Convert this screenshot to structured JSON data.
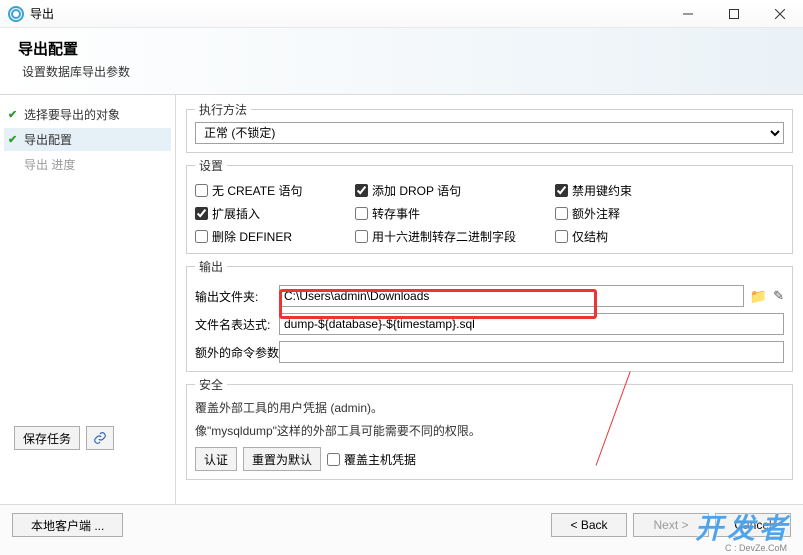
{
  "window": {
    "title": "导出"
  },
  "header": {
    "title": "导出配置",
    "subtitle": "设置数据库导出参数"
  },
  "steps": [
    {
      "label": "选择要导出的对象",
      "state": "done"
    },
    {
      "label": "导出配置",
      "state": "current"
    },
    {
      "label": "导出 进度",
      "state": "pending"
    }
  ],
  "method": {
    "legend": "执行方法",
    "selected": "正常 (不锁定)"
  },
  "settings": {
    "legend": "设置",
    "items": [
      {
        "label": "无 CREATE 语句",
        "checked": false
      },
      {
        "label": "添加 DROP 语句",
        "checked": true
      },
      {
        "label": "禁用键约束",
        "checked": true
      },
      {
        "label": "扩展插入",
        "checked": true
      },
      {
        "label": "转存事件",
        "checked": false
      },
      {
        "label": "额外注释",
        "checked": false
      },
      {
        "label": "删除 DEFINER",
        "checked": false
      },
      {
        "label": "用十六进制转存二进制字段",
        "checked": false
      },
      {
        "label": "仅结构",
        "checked": false
      }
    ]
  },
  "output": {
    "legend": "输出",
    "folder_label": "输出文件夹:",
    "folder_value": "C:\\Users\\admin\\Downloads",
    "fileexpr_label": "文件名表达式:",
    "fileexpr_value": "dump-${database}-${timestamp}.sql",
    "extraargs_label": "额外的命令参数:",
    "extraargs_value": ""
  },
  "security": {
    "legend": "安全",
    "line1": "覆盖外部工具的用户凭据 (admin)。",
    "line2": "像\"mysqldump\"这样的外部工具可能需要不同的权限。",
    "auth_btn": "认证",
    "reset_btn": "重置为默认",
    "override_host": "覆盖主机凭据"
  },
  "sidebar_buttons": {
    "save_task": "保存任务"
  },
  "footer": {
    "local_client": "本地客户端 ...",
    "back": "< Back",
    "next": "Next >",
    "cancel": "Cancel"
  },
  "watermark": {
    "brand": "开发者",
    "sub": "C   :    DevZe.CoM"
  }
}
